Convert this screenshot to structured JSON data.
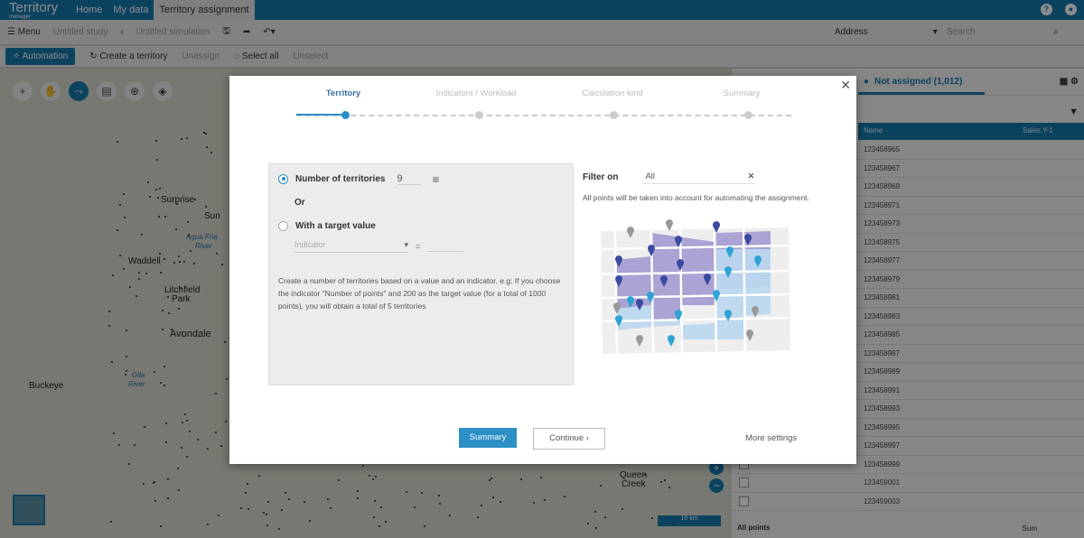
{
  "app": {
    "logo": "Territory",
    "logo_sub": "manager",
    "nav": [
      "Home",
      "My data",
      "Territory assignment"
    ],
    "active_nav": 2
  },
  "toolbar": {
    "menu": "Menu",
    "study": "Untitled study",
    "simulation": "Untitled simulation",
    "address_label": "Address",
    "search_placeholder": "Search"
  },
  "actions": {
    "automation": "Automation",
    "create": "Create a territory",
    "unassign": "Unassign",
    "select_all": "Select all",
    "unselect": "Unselect"
  },
  "map": {
    "places": [
      "Surprise",
      "Sun",
      "Waddell",
      "Litchfield",
      "Park",
      "Avondale",
      "Buckeye",
      "Queen",
      "Creek"
    ],
    "rivers": [
      "Agua Fria",
      "River",
      "Gila",
      "River"
    ],
    "scale": "10 km"
  },
  "panel": {
    "tab": "Not assigned (1,012)",
    "columns": [
      "Name",
      "Sales Y-1"
    ],
    "rows": [
      "123458965",
      "123458967",
      "123458969",
      "123458971",
      "123458973",
      "123458975",
      "123458977",
      "123458979",
      "123458981",
      "123458983",
      "123458985",
      "123458987",
      "123458989",
      "123458991",
      "123458993",
      "123458995",
      "123458997",
      "123458999",
      "123459001",
      "123459003"
    ],
    "footer": "All points",
    "sum": "Sum"
  },
  "modal": {
    "steps": [
      "Territory",
      "Indicators / Workload",
      "Calculation kind",
      "Summary"
    ],
    "current_step": 0,
    "opt1": "Number of territories",
    "opt1_value": "9",
    "or": "Or",
    "opt2": "With a target value",
    "indicator_placeholder": "Indicator",
    "equals": "=",
    "description": "Create a number of territories based on a value and an indicator. e.g: If you choose the indicator \"Number of points\" and 200 as the target value (for a total of 1000 points), you will obtain a total of 5 territories",
    "filter_label": "Filter on",
    "filter_value": "All",
    "filter_desc": "All points will be taken into account for automating the assignment.",
    "summary_btn": "Summary",
    "continue_btn": "Continue",
    "more_settings": "More settings"
  },
  "colors": {
    "brand": "#1479ad",
    "accent": "#2c8fc6",
    "purple": "#9c93cc",
    "lightblue": "#b9d6ec"
  }
}
